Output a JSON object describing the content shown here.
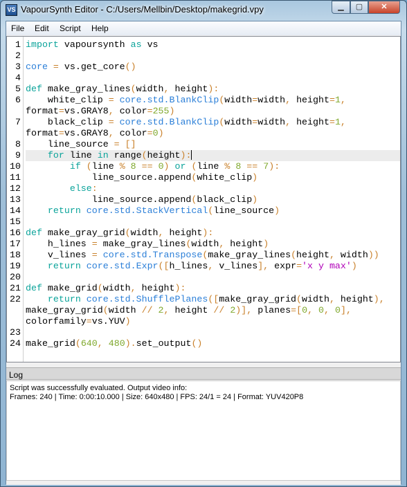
{
  "window": {
    "title": "VapourSynth Editor - C:/Users/Mellbin/Desktop/makegrid.vpy",
    "icon_text": "VS",
    "minimize": "▁",
    "maximize": "▢",
    "close": "✕"
  },
  "menu": [
    "File",
    "Edit",
    "Script",
    "Help"
  ],
  "colors": {
    "keyword": "#0aa39a",
    "core": "#2b7fd8",
    "operator": "#c9802a",
    "number": "#7fa82c",
    "string": "#b000b8",
    "current_line": "#ececec"
  },
  "editor": {
    "current_line": 9,
    "rows": [
      {
        "n": "1",
        "t": [
          [
            "k",
            "import"
          ],
          [
            "p",
            " vapoursynth "
          ],
          [
            "k",
            "as"
          ],
          [
            "p",
            " vs"
          ]
        ]
      },
      {
        "n": "2",
        "t": []
      },
      {
        "n": "3",
        "t": [
          [
            "c",
            "core"
          ],
          [
            "o",
            " = "
          ],
          [
            "p",
            "vs.get_core"
          ],
          [
            "o",
            "()"
          ]
        ]
      },
      {
        "n": "4",
        "t": []
      },
      {
        "n": "5",
        "t": [
          [
            "k",
            "def"
          ],
          [
            "p",
            " make_gray_lines"
          ],
          [
            "o",
            "("
          ],
          [
            "p",
            "width"
          ],
          [
            "o",
            ", "
          ],
          [
            "p",
            "height"
          ],
          [
            "o",
            "):"
          ]
        ]
      },
      {
        "n": "6",
        "t": [
          [
            "p",
            "    white_clip "
          ],
          [
            "o",
            "= "
          ],
          [
            "c",
            "core.std.BlankClip"
          ],
          [
            "o",
            "("
          ],
          [
            "p",
            "width"
          ],
          [
            "o",
            "="
          ],
          [
            "p",
            "width"
          ],
          [
            "o",
            ", "
          ],
          [
            "p",
            "height"
          ],
          [
            "o",
            "="
          ],
          [
            "n",
            "1"
          ],
          [
            "o",
            ","
          ]
        ]
      },
      {
        "n": "",
        "t": [
          [
            "p",
            "format"
          ],
          [
            "o",
            "="
          ],
          [
            "p",
            "vs.GRAY8"
          ],
          [
            "o",
            ", "
          ],
          [
            "p",
            "color"
          ],
          [
            "o",
            "="
          ],
          [
            "n",
            "255"
          ],
          [
            "o",
            ")"
          ]
        ]
      },
      {
        "n": "7",
        "t": [
          [
            "p",
            "    black_clip "
          ],
          [
            "o",
            "= "
          ],
          [
            "c",
            "core.std.BlankClip"
          ],
          [
            "o",
            "("
          ],
          [
            "p",
            "width"
          ],
          [
            "o",
            "="
          ],
          [
            "p",
            "width"
          ],
          [
            "o",
            ", "
          ],
          [
            "p",
            "height"
          ],
          [
            "o",
            "="
          ],
          [
            "n",
            "1"
          ],
          [
            "o",
            ","
          ]
        ]
      },
      {
        "n": "",
        "t": [
          [
            "p",
            "format"
          ],
          [
            "o",
            "="
          ],
          [
            "p",
            "vs.GRAY8"
          ],
          [
            "o",
            ", "
          ],
          [
            "p",
            "color"
          ],
          [
            "o",
            "="
          ],
          [
            "n",
            "0"
          ],
          [
            "o",
            ")"
          ]
        ]
      },
      {
        "n": "8",
        "t": [
          [
            "p",
            "    line_source "
          ],
          [
            "o",
            "= []"
          ]
        ]
      },
      {
        "n": "9",
        "cur": true,
        "t": [
          [
            "p",
            "    "
          ],
          [
            "k",
            "for"
          ],
          [
            "p",
            " line "
          ],
          [
            "k",
            "in"
          ],
          [
            "p",
            " range"
          ],
          [
            "o",
            "("
          ],
          [
            "p",
            "height"
          ],
          [
            "o",
            "):"
          ]
        ]
      },
      {
        "n": "10",
        "t": [
          [
            "p",
            "        "
          ],
          [
            "k",
            "if"
          ],
          [
            "o",
            " ("
          ],
          [
            "p",
            "line "
          ],
          [
            "o",
            "% "
          ],
          [
            "n",
            "8"
          ],
          [
            "o",
            " == "
          ],
          [
            "n",
            "0"
          ],
          [
            "o",
            ") "
          ],
          [
            "k",
            "or"
          ],
          [
            "o",
            " ("
          ],
          [
            "p",
            "line "
          ],
          [
            "o",
            "% "
          ],
          [
            "n",
            "8"
          ],
          [
            "o",
            " == "
          ],
          [
            "n",
            "7"
          ],
          [
            "o",
            "):"
          ]
        ]
      },
      {
        "n": "11",
        "t": [
          [
            "p",
            "            line_source.append"
          ],
          [
            "o",
            "("
          ],
          [
            "p",
            "white_clip"
          ],
          [
            "o",
            ")"
          ]
        ]
      },
      {
        "n": "12",
        "t": [
          [
            "p",
            "        "
          ],
          [
            "k",
            "else"
          ],
          [
            "o",
            ":"
          ]
        ]
      },
      {
        "n": "13",
        "t": [
          [
            "p",
            "            line_source.append"
          ],
          [
            "o",
            "("
          ],
          [
            "p",
            "black_clip"
          ],
          [
            "o",
            ")"
          ]
        ]
      },
      {
        "n": "14",
        "t": [
          [
            "p",
            "    "
          ],
          [
            "k",
            "return"
          ],
          [
            "p",
            " "
          ],
          [
            "c",
            "core.std.StackVertical"
          ],
          [
            "o",
            "("
          ],
          [
            "p",
            "line_source"
          ],
          [
            "o",
            ")"
          ]
        ]
      },
      {
        "n": "15",
        "t": []
      },
      {
        "n": "16",
        "t": [
          [
            "k",
            "def"
          ],
          [
            "p",
            " make_gray_grid"
          ],
          [
            "o",
            "("
          ],
          [
            "p",
            "width"
          ],
          [
            "o",
            ", "
          ],
          [
            "p",
            "height"
          ],
          [
            "o",
            "):"
          ]
        ]
      },
      {
        "n": "17",
        "t": [
          [
            "p",
            "    h_lines "
          ],
          [
            "o",
            "= "
          ],
          [
            "p",
            "make_gray_lines"
          ],
          [
            "o",
            "("
          ],
          [
            "p",
            "width"
          ],
          [
            "o",
            ", "
          ],
          [
            "p",
            "height"
          ],
          [
            "o",
            ")"
          ]
        ]
      },
      {
        "n": "18",
        "t": [
          [
            "p",
            "    v_lines "
          ],
          [
            "o",
            "= "
          ],
          [
            "c",
            "core.std.Transpose"
          ],
          [
            "o",
            "("
          ],
          [
            "p",
            "make_gray_lines"
          ],
          [
            "o",
            "("
          ],
          [
            "p",
            "height"
          ],
          [
            "o",
            ", "
          ],
          [
            "p",
            "width"
          ],
          [
            "o",
            "))"
          ]
        ]
      },
      {
        "n": "19",
        "t": [
          [
            "p",
            "    "
          ],
          [
            "k",
            "return"
          ],
          [
            "p",
            " "
          ],
          [
            "c",
            "core.std.Expr"
          ],
          [
            "o",
            "(["
          ],
          [
            "p",
            "h_lines"
          ],
          [
            "o",
            ", "
          ],
          [
            "p",
            "v_lines"
          ],
          [
            "o",
            "], "
          ],
          [
            "p",
            "expr"
          ],
          [
            "o",
            "="
          ],
          [
            "s",
            "'x y max'"
          ],
          [
            "o",
            ")"
          ]
        ]
      },
      {
        "n": "20",
        "t": []
      },
      {
        "n": "21",
        "t": [
          [
            "k",
            "def"
          ],
          [
            "p",
            " make_grid"
          ],
          [
            "o",
            "("
          ],
          [
            "p",
            "width"
          ],
          [
            "o",
            ", "
          ],
          [
            "p",
            "height"
          ],
          [
            "o",
            "):"
          ]
        ]
      },
      {
        "n": "22",
        "t": [
          [
            "p",
            "    "
          ],
          [
            "k",
            "return"
          ],
          [
            "p",
            " "
          ],
          [
            "c",
            "core.std.ShufflePlanes"
          ],
          [
            "o",
            "(["
          ],
          [
            "p",
            "make_gray_grid"
          ],
          [
            "o",
            "("
          ],
          [
            "p",
            "width"
          ],
          [
            "o",
            ", "
          ],
          [
            "p",
            "height"
          ],
          [
            "o",
            "),"
          ]
        ]
      },
      {
        "n": "",
        "t": [
          [
            "p",
            "make_gray_grid"
          ],
          [
            "o",
            "("
          ],
          [
            "p",
            "width "
          ],
          [
            "o",
            "// "
          ],
          [
            "n",
            "2"
          ],
          [
            "o",
            ", "
          ],
          [
            "p",
            "height "
          ],
          [
            "o",
            "// "
          ],
          [
            "n",
            "2"
          ],
          [
            "o",
            ")], "
          ],
          [
            "p",
            "planes"
          ],
          [
            "o",
            "=["
          ],
          [
            "n",
            "0"
          ],
          [
            "o",
            ", "
          ],
          [
            "n",
            "0"
          ],
          [
            "o",
            ", "
          ],
          [
            "n",
            "0"
          ],
          [
            "o",
            "],"
          ]
        ]
      },
      {
        "n": "",
        "t": [
          [
            "p",
            "colorfamily"
          ],
          [
            "o",
            "="
          ],
          [
            "p",
            "vs.YUV"
          ],
          [
            "o",
            ")"
          ]
        ]
      },
      {
        "n": "23",
        "t": []
      },
      {
        "n": "24",
        "t": [
          [
            "p",
            "make_grid"
          ],
          [
            "o",
            "("
          ],
          [
            "n",
            "640"
          ],
          [
            "o",
            ", "
          ],
          [
            "n",
            "480"
          ],
          [
            "o",
            ")."
          ],
          [
            "p",
            "set_output"
          ],
          [
            "o",
            "()"
          ]
        ]
      }
    ]
  },
  "log": {
    "title": "Log",
    "lines": [
      "Script was successfully evaluated. Output video info:",
      "Frames: 240 | Time: 0:00:10.000 | Size: 640x480 | FPS: 24/1 = 24 | Format: YUV420P8"
    ]
  }
}
